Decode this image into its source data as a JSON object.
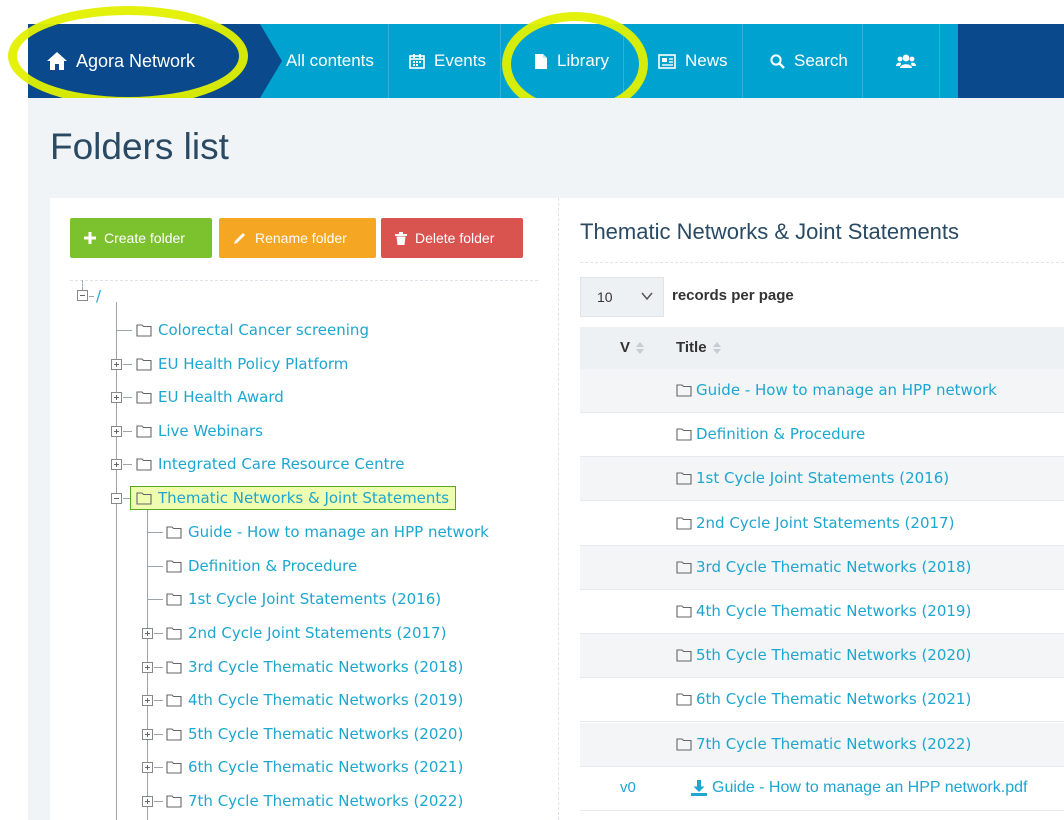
{
  "nav": {
    "brand": "Agora Network",
    "items": [
      {
        "label": "All contents",
        "icon": "none"
      },
      {
        "label": "Events",
        "icon": "calendar-icon"
      },
      {
        "label": "Library",
        "icon": "file-icon"
      },
      {
        "label": "News",
        "icon": "newspaper-icon"
      },
      {
        "label": "Search",
        "icon": "search-icon"
      },
      {
        "label": "",
        "icon": "users-icon"
      }
    ]
  },
  "page": {
    "title": "Folders list"
  },
  "toolbar": {
    "create": "Create folder",
    "rename": "Rename folder",
    "delete": "Delete folder"
  },
  "tree": {
    "root": "/",
    "nodes": [
      {
        "label": "Colorectal Cancer screening",
        "expandable": false
      },
      {
        "label": "EU Health Policy Platform",
        "expandable": true
      },
      {
        "label": "EU Health Award",
        "expandable": true
      },
      {
        "label": "Live Webinars",
        "expandable": true
      },
      {
        "label": "Integrated Care Resource Centre",
        "expandable": true
      },
      {
        "label": "Thematic Networks & Joint Statements",
        "expandable": true,
        "expanded": true,
        "selected": true
      }
    ],
    "children": [
      {
        "label": "Guide - How to manage an HPP network",
        "expandable": false
      },
      {
        "label": "Definition & Procedure",
        "expandable": false
      },
      {
        "label": "1st Cycle Joint Statements (2016)",
        "expandable": false
      },
      {
        "label": "2nd Cycle Joint Statements (2017)",
        "expandable": true
      },
      {
        "label": "3rd Cycle Thematic Networks (2018)",
        "expandable": true
      },
      {
        "label": "4th Cycle Thematic Networks (2019)",
        "expandable": true
      },
      {
        "label": "5th Cycle Thematic Networks (2020)",
        "expandable": true
      },
      {
        "label": "6th Cycle Thematic Networks (2021)",
        "expandable": true
      },
      {
        "label": "7th Cycle Thematic Networks (2022)",
        "expandable": true
      }
    ]
  },
  "detail": {
    "title": "Thematic Networks & Joint Statements",
    "page_size": "10",
    "records_label": "records per page",
    "columns": {
      "version": "V",
      "title": "Title"
    },
    "rows": [
      {
        "version": "",
        "title": "Guide - How to manage an HPP network",
        "type": "folder"
      },
      {
        "version": "",
        "title": "Definition & Procedure",
        "type": "folder"
      },
      {
        "version": "",
        "title": "1st Cycle Joint Statements (2016)",
        "type": "folder"
      },
      {
        "version": "",
        "title": "2nd Cycle Joint Statements (2017)",
        "type": "folder"
      },
      {
        "version": "",
        "title": "3rd Cycle Thematic Networks (2018)",
        "type": "folder"
      },
      {
        "version": "",
        "title": "4th Cycle Thematic Networks (2019)",
        "type": "folder"
      },
      {
        "version": "",
        "title": "5th Cycle Thematic Networks (2020)",
        "type": "folder"
      },
      {
        "version": "",
        "title": "6th Cycle Thematic Networks (2021)",
        "type": "folder"
      },
      {
        "version": "",
        "title": "7th Cycle Thematic Networks (2022)",
        "type": "folder"
      },
      {
        "version": "v0",
        "title": "Guide - How to manage an HPP network.pdf",
        "type": "file"
      }
    ]
  },
  "colors": {
    "nav_bg": "#00a3cf",
    "brand_bg": "#0a4a8c",
    "link": "#1da6cf",
    "create": "#7cc22f",
    "rename": "#f5a623",
    "delete": "#d9534f",
    "highlight": "#e1f000"
  }
}
